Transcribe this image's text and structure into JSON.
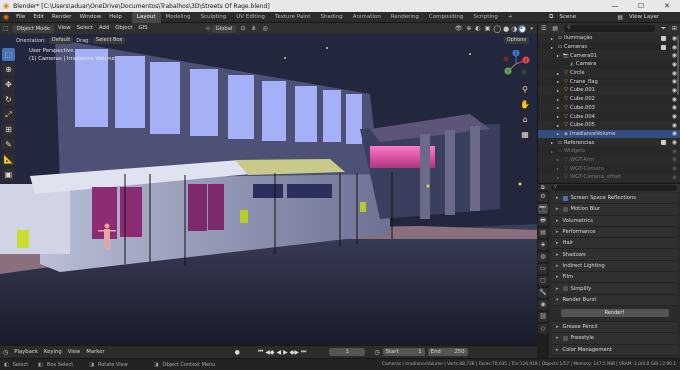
{
  "window": {
    "title": "Blender* [C:\\Users\\aduar\\OneDrive\\Documentos\\Trabalhos\\3D\\Streets Of Rage.blend]",
    "controls": [
      "—",
      "☐",
      "✕"
    ]
  },
  "menu": {
    "items": [
      "File",
      "Edit",
      "Render",
      "Window",
      "Help"
    ],
    "workspaces": [
      "Layout",
      "Modeling",
      "Sculpting",
      "UV Editing",
      "Texture Paint",
      "Shading",
      "Animation",
      "Rendering",
      "Compositing",
      "Scripting"
    ],
    "active_workspace": "Layout",
    "scene_label": "Scene",
    "view_layer_label": "View Layer"
  },
  "viewport_header": {
    "mode": "Object Mode",
    "menus": [
      "View",
      "Select",
      "Add",
      "Object",
      "GIS"
    ],
    "transform": "Global",
    "orientation_label": "Orientation:",
    "orientation_value": "Default",
    "drag_label": "Drag:",
    "drag_value": "Select Box",
    "options": "Options"
  },
  "viewport": {
    "perspective": "User Perspective",
    "collection": "(1) Cameras | Irradiance Volume",
    "gizmo_axes": [
      "X",
      "Y",
      "Z"
    ]
  },
  "outliner": {
    "rows": [
      {
        "label": "Iluminação",
        "icon": "collection-icon",
        "indent": 1,
        "check": true
      },
      {
        "label": "Cameras",
        "icon": "collection-icon",
        "indent": 1,
        "check": true
      },
      {
        "label": "Camera01",
        "icon": "camera-icon",
        "indent": 2
      },
      {
        "label": "Camera",
        "icon": "camera-data-icon",
        "indent": 3
      },
      {
        "label": "Circle",
        "icon": "mesh-icon",
        "indent": 2
      },
      {
        "label": "Crane_flag",
        "icon": "mesh-icon",
        "indent": 2
      },
      {
        "label": "Cube.001",
        "icon": "mesh-icon",
        "indent": 2
      },
      {
        "label": "Cube.002",
        "icon": "mesh-icon",
        "indent": 2
      },
      {
        "label": "Cube.003",
        "icon": "mesh-icon",
        "indent": 2
      },
      {
        "label": "Cube.004",
        "icon": "mesh-icon",
        "indent": 2
      },
      {
        "label": "Cube.005",
        "icon": "mesh-icon",
        "indent": 2
      },
      {
        "label": "IrradianceVolume",
        "icon": "light-probe-icon",
        "indent": 2,
        "selected": true
      },
      {
        "label": "Referencias",
        "icon": "collection-icon",
        "indent": 1,
        "check": true
      },
      {
        "label": "Widgets",
        "icon": "collection-icon",
        "indent": 1,
        "dim": true
      },
      {
        "label": "WGT-Arm",
        "icon": "mesh-icon",
        "indent": 2,
        "dim": true
      },
      {
        "label": "WGT-Camera",
        "icon": "mesh-icon",
        "indent": 2,
        "dim": true
      },
      {
        "label": "WGT-Camera_offset",
        "icon": "mesh-icon",
        "indent": 2,
        "dim": true
      }
    ]
  },
  "properties": {
    "sections": [
      {
        "label": "Screen Space Reflections",
        "checkbox": true
      },
      {
        "label": "Motion Blur",
        "checkbox": false
      },
      {
        "label": "Volumetrics"
      },
      {
        "label": "Performance"
      },
      {
        "label": "Hair"
      },
      {
        "label": "Shadows"
      },
      {
        "label": "Indirect Lighting"
      },
      {
        "label": "Film"
      },
      {
        "label": "Simplify",
        "checkbox": false
      },
      {
        "label": "Render Burst",
        "expanded": true
      },
      {
        "label": "Grease Pencil"
      },
      {
        "label": "Freestyle",
        "checkbox": false
      },
      {
        "label": "Color Management"
      }
    ],
    "render_button": "Render!"
  },
  "timeline": {
    "menus": [
      "Playback",
      "Keying",
      "View",
      "Marker"
    ],
    "current_frame": "1",
    "start_label": "Start",
    "start_value": "1",
    "end_label": "End",
    "end_value": "250"
  },
  "statusbar": {
    "items": [
      "Select",
      "Box Select",
      "Rotate View",
      "Object Context Menu"
    ],
    "info": "Cameras | IrradianceVolume | Verts:88,738 | Faces:70,035 | Tris:126,918 | Objects:1/57 | Memory: 147.5 MiB | VRAM: 1.0/4.0 GiB | 2.90.1"
  }
}
